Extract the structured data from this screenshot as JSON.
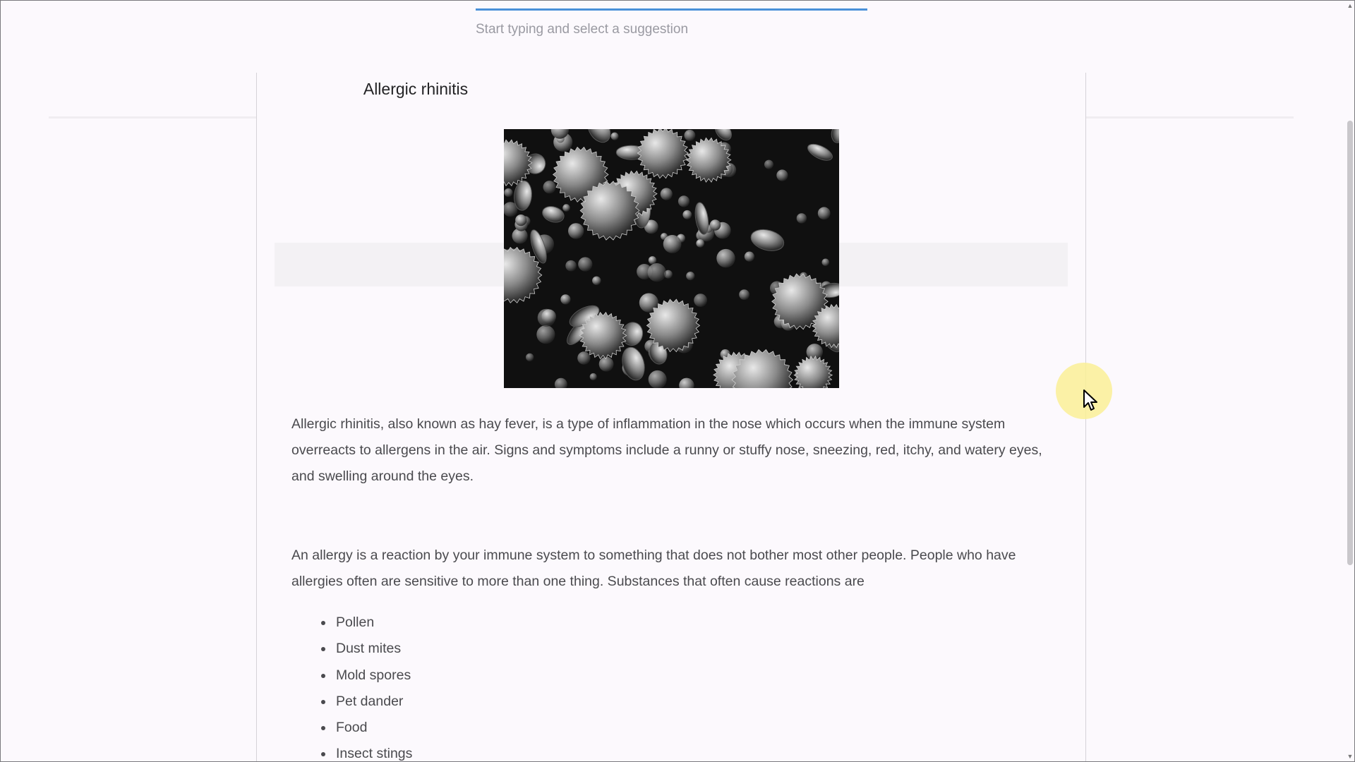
{
  "search": {
    "placeholder": "Start typing and select a suggestion",
    "value": ""
  },
  "article": {
    "title": "Allergic rhinitis",
    "image_alt": "Pollen grains under electron microscope",
    "paragraphs": [
      "Allergic rhinitis, also known as hay fever, is a type of inflammation in the nose which occurs when the immune system overreacts to allergens in the air. Signs and symptoms include a runny or stuffy nose, sneezing, red, itchy, and watery eyes, and swelling around the eyes.",
      "An allergy is a reaction by your immune system to something that does not bother most other people. People who have allergies often are sensitive to more than one thing. Substances that often cause reactions are"
    ],
    "allergens": [
      "Pollen",
      "Dust mites",
      "Mold spores",
      "Pet dander",
      "Food",
      "Insect stings"
    ]
  },
  "colors": {
    "accent": "#4a90d9",
    "background": "#fcf9fd",
    "text": "#4a4a4e",
    "cursor_highlight": "#faf096"
  },
  "icons": {
    "cursor": "arrow-cursor-icon",
    "scroll_up": "scroll-up-arrow-icon",
    "scroll_down": "scroll-down-arrow-icon"
  }
}
